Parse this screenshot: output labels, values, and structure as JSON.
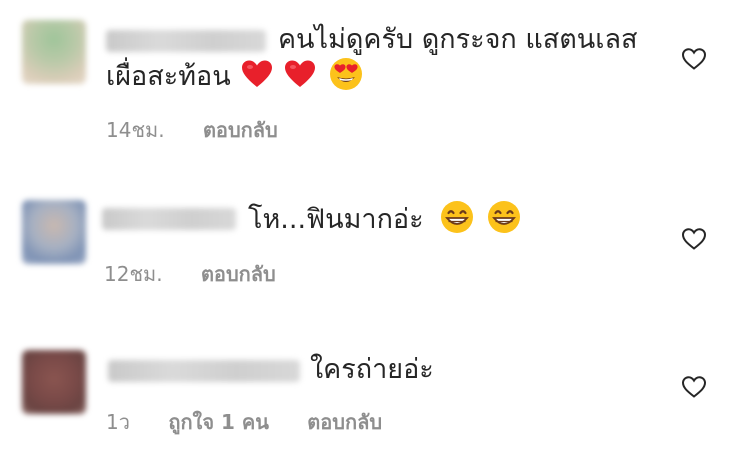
{
  "comments": [
    {
      "text_line1": "คนไม่ดูครับ ดูกระจก แสตนเลส",
      "text_line2": "เผื่อสะท้อน",
      "emojis": [
        "red-heart",
        "red-heart",
        "heart-eyes-face"
      ],
      "time": "14ชม.",
      "reply_label": "ตอบกลับ",
      "likes_label": ""
    },
    {
      "text_line1": "โห...ฟินมากอ่ะ",
      "emojis": [
        "grinning-face",
        "grinning-face"
      ],
      "time": "12ชม.",
      "reply_label": "ตอบกลับ",
      "likes_label": ""
    },
    {
      "text_line1": "ใครถ่ายอ่ะ",
      "emojis": [],
      "time": "1ว",
      "likes_label": "ถูกใจ 1 คน",
      "reply_label": "ตอบกลับ"
    }
  ],
  "colors": {
    "text": "#262626",
    "meta": "#8e8e8e",
    "heart_emoji": "#e8202b",
    "face_emoji": "#fcc21b"
  }
}
